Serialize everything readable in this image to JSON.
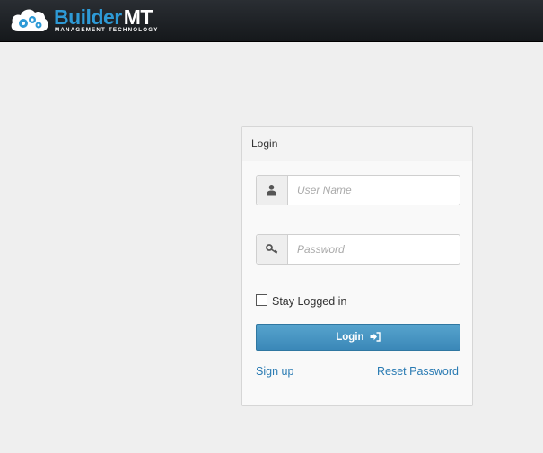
{
  "header": {
    "logo_word_builder": "Builder",
    "logo_word_mt": "MT",
    "logo_tagline": "MANAGEMENT TECHNOLOGY"
  },
  "login": {
    "title": "Login",
    "username": {
      "placeholder": "User Name",
      "value": ""
    },
    "password": {
      "placeholder": "Password",
      "value": ""
    },
    "remember_label": "Stay Logged in",
    "remember_checked": false,
    "submit_label": "Login",
    "signup_link": "Sign up",
    "reset_link": "Reset Password"
  },
  "icons": {
    "logo": "cloud-gears-icon",
    "username": "user-icon",
    "password": "key-icon",
    "submit": "sign-in-icon"
  },
  "colors": {
    "accent": "#2e9ad6",
    "button": "#4a96c4",
    "link": "#2a7bb3",
    "topbar": "#1e2226"
  }
}
